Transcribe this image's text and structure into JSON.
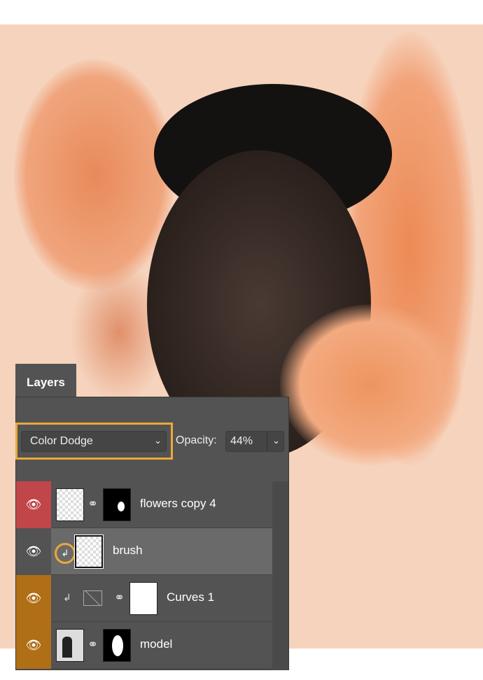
{
  "panel": {
    "tab": "Layers",
    "blend_mode": "Color Dodge",
    "opacity_label": "Opacity:",
    "opacity_value": "44%"
  },
  "layers": [
    {
      "name": "flowers copy 4",
      "eye_color": "#c0464a",
      "selected": false
    },
    {
      "name": "brush",
      "eye_color": "#535353",
      "selected": true,
      "clipped": true
    },
    {
      "name": "Curves 1",
      "eye_color": "#b06e16",
      "selected": false,
      "clipped": true
    },
    {
      "name": "model",
      "eye_color": "#b06e16",
      "selected": false
    }
  ],
  "colors": {
    "highlight": "#e9a93c",
    "background": "#f6d3bd"
  }
}
